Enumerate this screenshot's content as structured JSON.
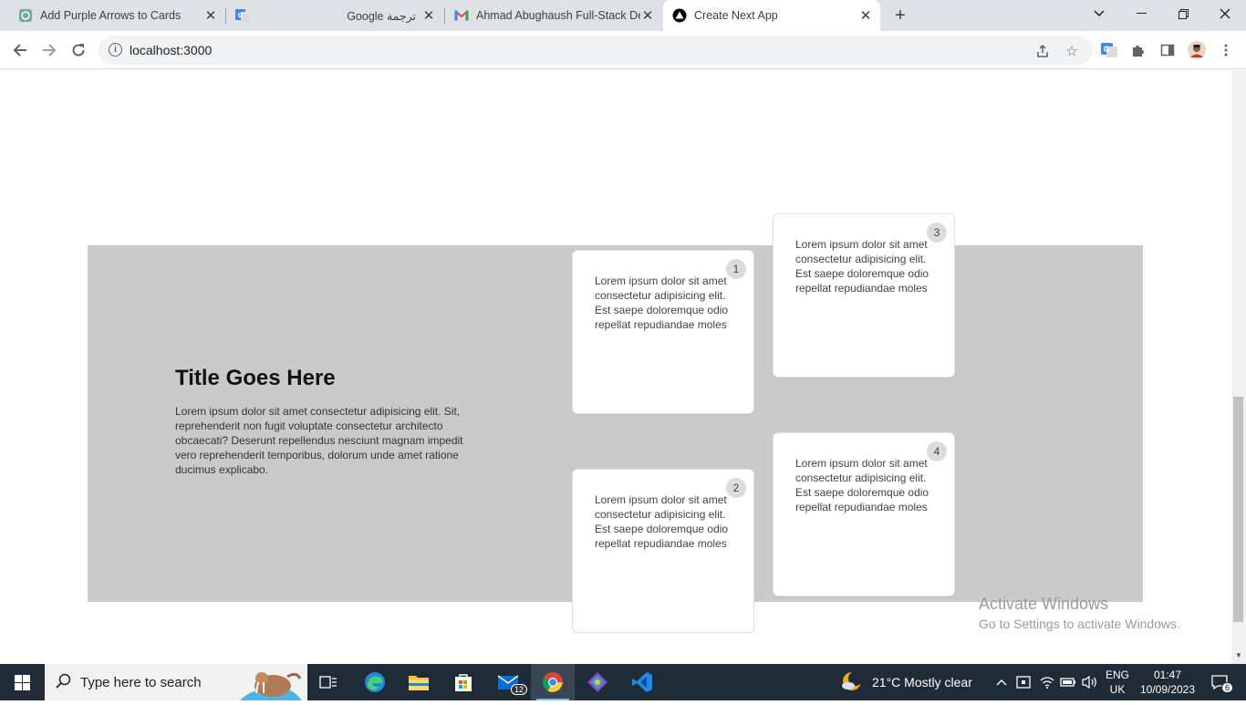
{
  "browser": {
    "tabs": [
      {
        "title": "Add Purple Arrows to Cards",
        "icon": "chatgpt-icon"
      },
      {
        "title": "Google ترجمة",
        "icon": "google-translate-icon"
      },
      {
        "title": "Ahmad Abughaush Full-Stack De",
        "icon": "gmail-icon"
      },
      {
        "title": "Create Next App",
        "icon": "nextjs-icon"
      }
    ],
    "url": "localhost:3000"
  },
  "page": {
    "title": "Title Goes Here",
    "description": "Lorem ipsum dolor sit amet consectetur adipisicing elit. Sit, reprehenderit non fugit voluptate consectetur architecto obcaecati? Deserunt repellendus nesciunt magnam impedit vero reprehenderit temporibus, dolorum unde amet ratione ducimus explicabo.",
    "section_bg": "#cacaca",
    "cards": [
      {
        "number": "1",
        "text": "Lorem ipsum dolor sit amet consectetur adipisicing elit. Est saepe doloremque odio repellat repudiandae moles"
      },
      {
        "number": "2",
        "text": "Lorem ipsum dolor sit amet consectetur adipisicing elit. Est saepe doloremque odio repellat repudiandae moles"
      },
      {
        "number": "3",
        "text": "Lorem ipsum dolor sit amet consectetur adipisicing elit. Est saepe doloremque odio repellat repudiandae moles"
      },
      {
        "number": "4",
        "text": "Lorem ipsum dolor sit amet consectetur adipisicing elit. Est saepe doloremque odio repellat repudiandae moles"
      }
    ]
  },
  "watermark": {
    "line1": "Activate Windows",
    "line2": "Go to Settings to activate Windows."
  },
  "taskbar": {
    "search_placeholder": "Type here to search",
    "mail_badge": "12",
    "weather": "21°C  Mostly clear",
    "language": "ENG",
    "region": "UK",
    "time": "01:47",
    "date": "10/09/2023",
    "notification_count": "6"
  }
}
